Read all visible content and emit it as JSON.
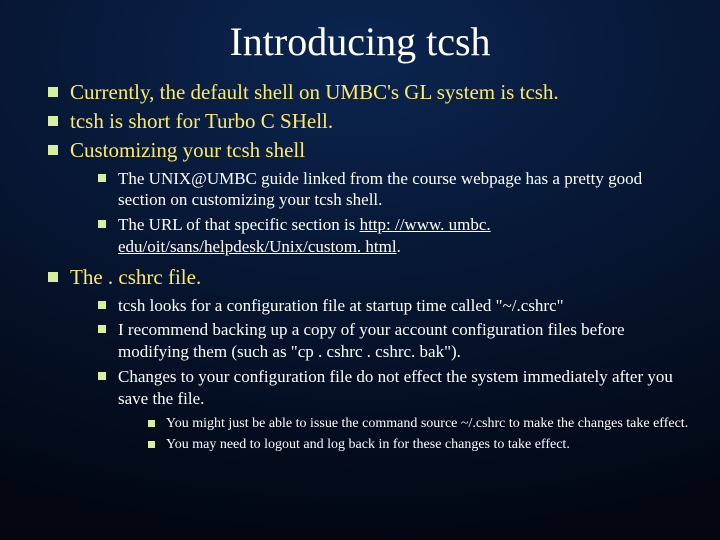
{
  "title": "Introducing tcsh",
  "b1": "Currently, the default shell on UMBC's GL system is tcsh.",
  "b2": "tcsh is short for Turbo C SHell.",
  "b3": "Customizing your tcsh shell",
  "b3a": "The UNIX@UMBC guide linked from the course webpage has a pretty good section on customizing your tcsh shell.",
  "b3b_pre": "The URL of that specific section is ",
  "b3b_url": "http: //www. umbc. edu/oit/sans/helpdesk/Unix/custom. html",
  "b3b_post": ".",
  "b4": "The . cshrc file.",
  "b4a": "tcsh looks for a configuration file at startup time called \"~/.cshrc\"",
  "b4b": "I recommend backing up a copy of your account configuration files before modifying them (such as \"cp . cshrc . cshrc. bak\").",
  "b4c": "Changes to your configuration file do not effect the system immediately after you save the file.",
  "b4c1": "You might just be able to issue the command source ~/.cshrc to make the changes take effect.",
  "b4c2": "You may need to logout and log back in for these changes to take effect."
}
